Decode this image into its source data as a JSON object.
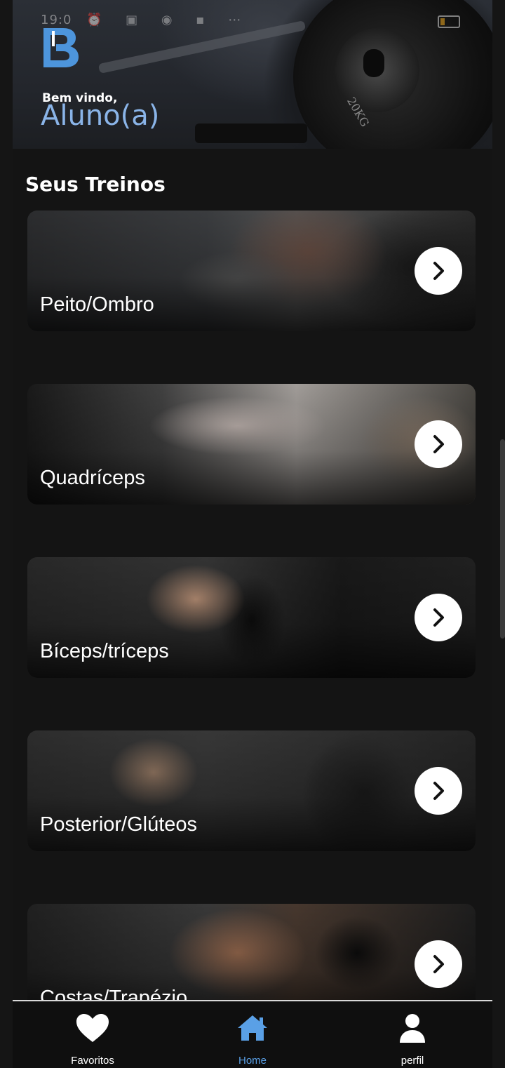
{
  "status_bar": {
    "time": "19:0"
  },
  "header": {
    "welcome": "Bem vindo,",
    "student": "Aluno(a)",
    "plate_marking": "20KG"
  },
  "section": {
    "title": "Seus Treinos"
  },
  "workouts": [
    {
      "label": "Peito/Ombro"
    },
    {
      "label": "Quadríceps"
    },
    {
      "label": "Bíceps/tríceps"
    },
    {
      "label": "Posterior/Glúteos"
    },
    {
      "label": "Costas/Trapézio"
    }
  ],
  "tabs": [
    {
      "label": "Favoritos",
      "icon": "heart-icon"
    },
    {
      "label": "Home",
      "icon": "home-icon",
      "active": true
    },
    {
      "label": "perfil",
      "icon": "user-icon"
    }
  ],
  "colors": {
    "accent": "#5aa0e6",
    "name": "#8ab4e8",
    "background": "#141414"
  }
}
